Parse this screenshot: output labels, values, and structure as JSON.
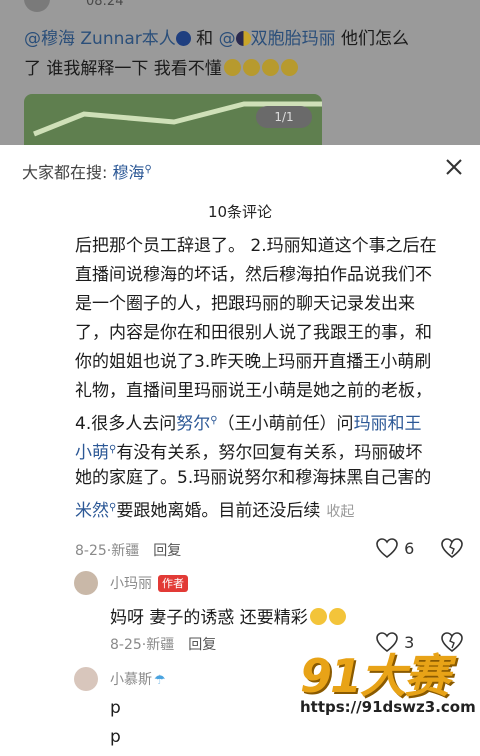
{
  "background_post": {
    "time": "08:24",
    "line1_prefix": "@穆海 Zunnar本人",
    "line1_mid": " 和 ",
    "line1_mention2": "@",
    "line1_mention2_name": "双胞胎玛丽",
    "line1_suffix": "  他们怎么",
    "line2": "了 谁我解释一下 我看不懂",
    "image_counter": "1/1"
  },
  "sheet": {
    "search_label": "大家都在搜: ",
    "search_keyword": "穆海",
    "search_icon": "search-icon",
    "comments_title": "10条评论"
  },
  "main_comment": {
    "lines": [
      "后把那个员工辞退了。 2.玛丽知道这个事之后在",
      "直播间说穆海的坏话，然后穆海拍作品说我们不",
      "是一个圈子的人，把跟玛丽的聊天记录发出来",
      "了，内容是你在和田很别人说了我跟王的事，和",
      "你的姐姐也说了3.昨天晚上玛丽开直播王小萌刷",
      "礼物，直播间里玛丽说王小萌是她之前的老板，"
    ],
    "line7_a": "4.很多人去问",
    "line7_link": "努尔",
    "line7_b": "（王小萌前任）问",
    "line7_link2": "玛丽和王",
    "line8_link": "小萌",
    "line8_b": "有没有关系，努尔回复有关系，玛丽破坏",
    "line9": "她的家庭了。5.玛丽说努尔和穆海抹黑自己害的",
    "line10_link": "米然",
    "line10_b": "要跟她离婚。目前还没后续",
    "collapse": "收起",
    "date": "8-25",
    "location": "新疆",
    "reply": "回复",
    "likes": "6"
  },
  "reply1": {
    "name": "小玛丽",
    "badge": "作者",
    "text": "妈呀 妻子的诱惑 还要精彩",
    "date": "8-25",
    "location": "新疆",
    "reply": "回复",
    "likes": "3"
  },
  "reply2": {
    "name": "小慕斯",
    "line1": "p",
    "line2": "p"
  },
  "watermark": {
    "logo": "91大赛",
    "url": "https://91dswz3.com"
  }
}
